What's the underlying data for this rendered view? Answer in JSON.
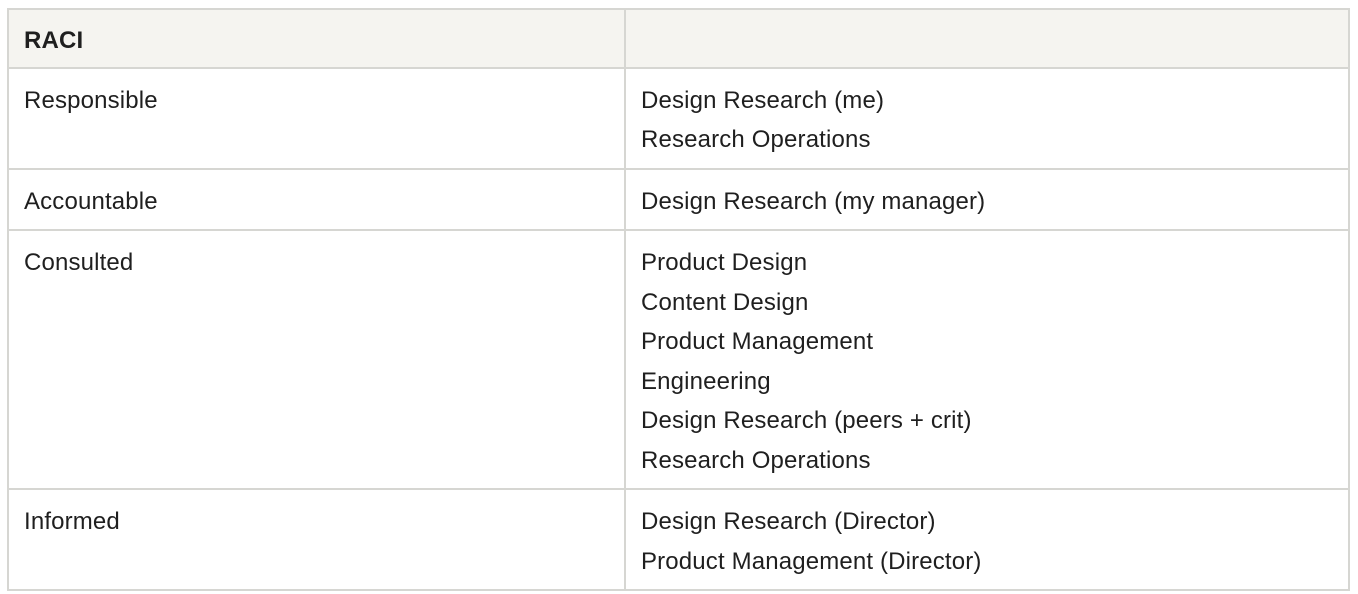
{
  "table": {
    "header": [
      "RACI",
      ""
    ],
    "rows": [
      {
        "role": "Responsible",
        "parties": [
          "Design Research (me)",
          "Research Operations"
        ]
      },
      {
        "role": "Accountable",
        "parties": [
          "Design Research (my manager)"
        ]
      },
      {
        "role": "Consulted",
        "parties": [
          "Product Design",
          "Content Design",
          "Product Management",
          "Engineering",
          "Design Research (peers + crit)",
          "Research Operations"
        ]
      },
      {
        "role": "Informed",
        "parties": [
          "Design Research (Director)",
          "Product Management (Director)"
        ]
      }
    ]
  },
  "colors": {
    "header_bg": "#f5f4f0",
    "border": "#d6d6d2",
    "text": "#1f1f1f"
  }
}
